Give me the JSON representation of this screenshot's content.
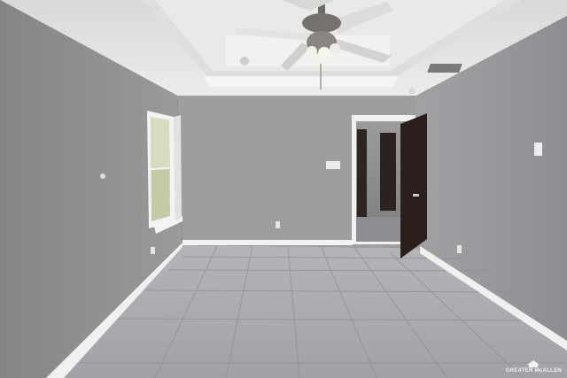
{
  "photo": {
    "subject": "empty-room-interior",
    "watermark": {
      "text": "GREATER McALLEN"
    },
    "colors": {
      "ceiling": "#e4e4e2",
      "wall": "#9c9c9e",
      "wall_left": "#8f8f92",
      "floor": "#a9aaae",
      "baseboard": "#f2f2f2",
      "door": "#2b1f1d",
      "fan_metal": "#6d6a66",
      "fan_blade": "#d9d9d8"
    }
  }
}
